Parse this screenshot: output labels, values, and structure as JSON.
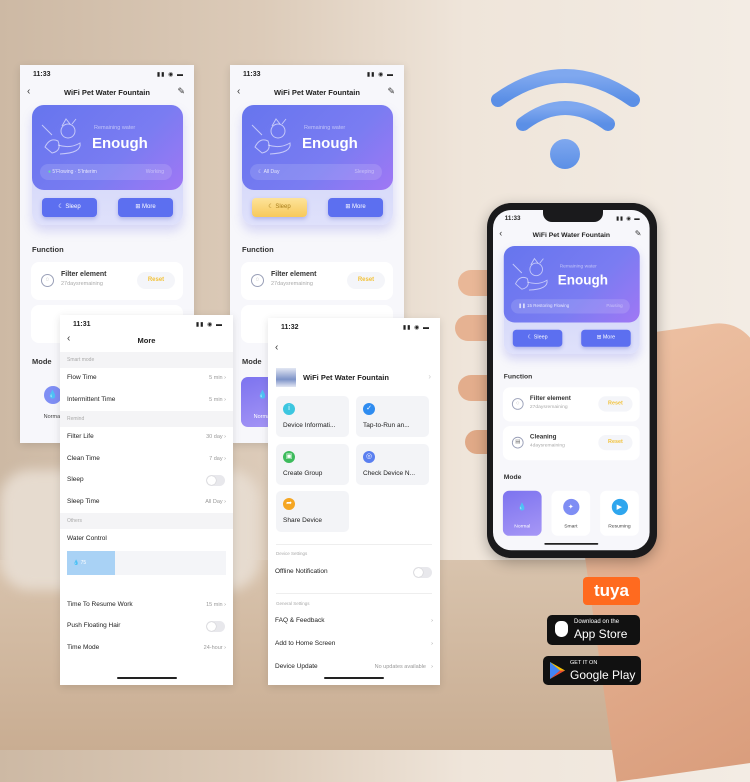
{
  "colors": {
    "accent": "#6675ee",
    "reset": "#f2c23a",
    "sleep_active": "#f7c95a",
    "tuya": "#ff6a1f"
  },
  "main_screens": [
    {
      "time": "11:33",
      "title": "WiFi Pet Water Fountain",
      "remaining_label": "Remaining water",
      "remaining_value": "Enough",
      "status_left": "5'Flowing · 5'Interim",
      "status_right": "Working",
      "status_icon": "dot",
      "sleep_label": "Sleep",
      "more_label": "More",
      "sleep_active": false,
      "function_label": "Function",
      "functions": [
        {
          "title": "Filter element",
          "subtitle": "27daysremaining",
          "action": "Reset"
        }
      ],
      "mode_label": "Mode",
      "modes": [
        {
          "label": "Normal",
          "selected": false
        }
      ]
    },
    {
      "time": "11:33",
      "title": "WiFi Pet Water Fountain",
      "remaining_label": "Remaining water",
      "remaining_value": "Enough",
      "status_left": "All Day",
      "status_right": "Sleeping",
      "status_icon": "moon",
      "sleep_label": "Sleep",
      "more_label": "More",
      "sleep_active": true,
      "function_label": "Function",
      "functions": [
        {
          "title": "Filter element",
          "subtitle": "27daysremaining",
          "action": "Reset"
        }
      ],
      "mode_label": "Mode",
      "modes": [
        {
          "label": "Normal",
          "selected": true
        }
      ]
    },
    {
      "time": "11:33",
      "title": "WiFi Pet Water Fountain",
      "remaining_label": "Remaining water",
      "remaining_value": "Enough",
      "status_left": "15 Restoring Flowing",
      "status_right": "Pausing",
      "status_icon": "pause",
      "sleep_label": "Sleep",
      "more_label": "More",
      "sleep_active": false,
      "function_label": "Function",
      "functions": [
        {
          "title": "Filter element",
          "subtitle": "27daysremaining",
          "action": "Reset"
        },
        {
          "title": "Cleaning",
          "subtitle": "4daysremaining",
          "action": "Reset"
        }
      ],
      "mode_label": "Mode",
      "modes": [
        {
          "label": "Normal",
          "selected": true
        },
        {
          "label": "Smart",
          "selected": false
        },
        {
          "label": "Resuming",
          "selected": false
        }
      ]
    }
  ],
  "more_screen": {
    "time": "11:31",
    "title": "More",
    "items": [
      {
        "type": "band",
        "label": "Smart mode"
      },
      {
        "type": "row",
        "label": "Flow Time",
        "value": "5 min"
      },
      {
        "type": "row",
        "label": "Intermittent Time",
        "value": "5 min"
      },
      {
        "type": "band",
        "label": "Remind"
      },
      {
        "type": "row",
        "label": "Filter Life",
        "value": "30 day"
      },
      {
        "type": "row",
        "label": "Clean Time",
        "value": "7 day"
      },
      {
        "type": "toggle",
        "label": "Sleep",
        "on": false
      },
      {
        "type": "row",
        "label": "Sleep Time",
        "value": "All Day"
      },
      {
        "type": "band",
        "label": "Others"
      },
      {
        "type": "row",
        "label": "Water Control",
        "value": ""
      },
      {
        "type": "slider",
        "label": "75",
        "level": 0.3
      },
      {
        "type": "row",
        "label": "Time To Resume Work",
        "value": "15 min"
      },
      {
        "type": "toggle",
        "label": "Push Floating Hair",
        "on": false
      },
      {
        "type": "row",
        "label": "Time Mode",
        "value": "24-hour"
      }
    ]
  },
  "settings_screen": {
    "time": "11:32",
    "device_name": "WiFi Pet Water Fountain",
    "tiles": [
      {
        "label": "Device Informati...",
        "icon": "info-icon",
        "color": "#3cc6e0"
      },
      {
        "label": "Tap-to-Run an...",
        "icon": "check-icon",
        "color": "#2f8cf0"
      },
      {
        "label": "Create Group",
        "icon": "group-icon",
        "color": "#3dbb5c"
      },
      {
        "label": "Check Device N...",
        "icon": "network-icon",
        "color": "#5a7ff0"
      },
      {
        "label": "Share Device",
        "icon": "share-icon",
        "color": "#f5a623"
      }
    ],
    "device_settings_label": "Device Settings",
    "offline_notification": "Offline Notification",
    "general_settings_label": "General Settings",
    "faq": "FAQ & Feedback",
    "add_home": "Add to Home Screen",
    "device_update": "Device Update",
    "device_update_value": "No updates available"
  },
  "badges": {
    "tuya": "tuya",
    "appstore_small": "Download on the",
    "appstore_big": "App Store",
    "play_small": "GET IT ON",
    "play_big": "Google Play"
  }
}
